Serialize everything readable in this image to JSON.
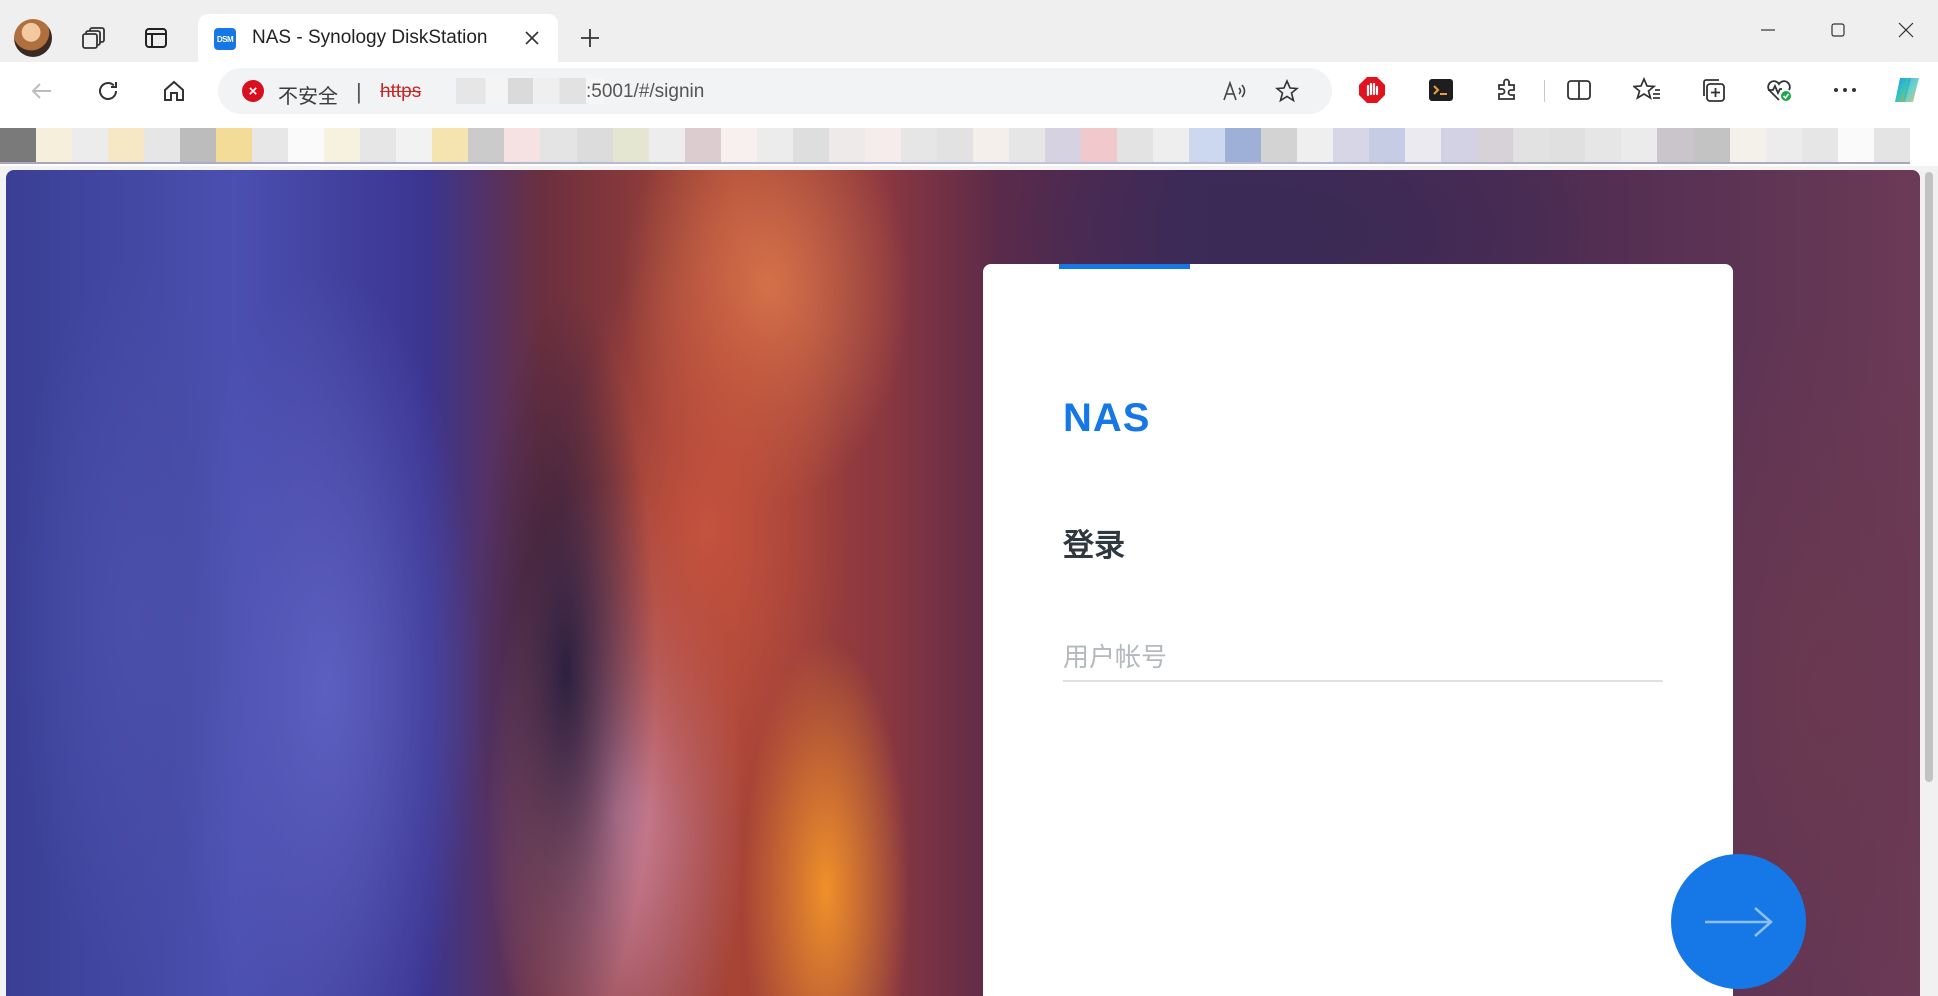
{
  "browser": {
    "tab": {
      "favicon_text": "DSM",
      "title": "NAS - Synology DiskStation"
    },
    "address_bar": {
      "security_label": "不安全",
      "separator": "|",
      "scheme": "https",
      "url_rest": ":5001/#/signin"
    },
    "icons": {
      "workspaces": "workspaces-icon",
      "tab_actions": "tab-actions-icon",
      "close_tab": "close-icon",
      "new_tab": "plus-icon",
      "minimize": "minimize-icon",
      "maximize": "maximize-icon",
      "close_window": "close-icon",
      "back": "back-arrow-icon",
      "refresh": "refresh-icon",
      "home": "home-icon",
      "read_aloud": "read-aloud-icon",
      "favorite": "star-icon",
      "adblock": "adblock-icon",
      "terminal": "terminal-icon",
      "extensions": "puzzle-icon",
      "split_screen": "split-screen-icon",
      "favorites": "favorites-icon",
      "collections": "collections-icon",
      "performance": "heartbeat-icon",
      "more": "more-icon",
      "copilot": "copilot-icon"
    },
    "favorites_bar_colors": [
      "#7a7a7a",
      "#f5efdc",
      "#ececec",
      "#f6e8c4",
      "#e6e6e6",
      "#bcbcbc",
      "#f2dc98",
      "#e7e7e7",
      "#fafafa",
      "#f7f1df",
      "#e6e6e6",
      "#f2f2f2",
      "#f5e4b0",
      "#cbcbcb",
      "#f6e2e2",
      "#e4e4e4",
      "#dcdcdc",
      "#e4e6d2",
      "#ededed",
      "#dcccd0",
      "#f8efef",
      "#ececec",
      "#dedede",
      "#eeeaea",
      "#f6ecec",
      "#e6e6e6",
      "#e2e2e2",
      "#f4efeb",
      "#e6e6e6",
      "#d7d2e1",
      "#f1c8cb",
      "#e3e3e3",
      "#eeeeee",
      "#cbd8ef",
      "#9fb0d8",
      "#d3d3d3",
      "#efefef",
      "#d7d6e6",
      "#c6cce4",
      "#eaeaf0",
      "#d2d2e4",
      "#d6d2d8",
      "#e2e2e2",
      "#e0e0e0",
      "#e6e6e6",
      "#ebebeb",
      "#cac5ca",
      "#c3c3c3",
      "#f4f1ea",
      "#ececec",
      "#e6e6e6",
      "#fafafa",
      "#e4e4e4"
    ]
  },
  "page": {
    "card": {
      "product_name": "NAS",
      "heading": "登录",
      "username_placeholder": "用户帐号"
    },
    "submit_icon": "arrow-right-icon",
    "colors": {
      "accent": "#1677e6",
      "heading": "#2e3840",
      "placeholder": "#b4b9be"
    }
  }
}
